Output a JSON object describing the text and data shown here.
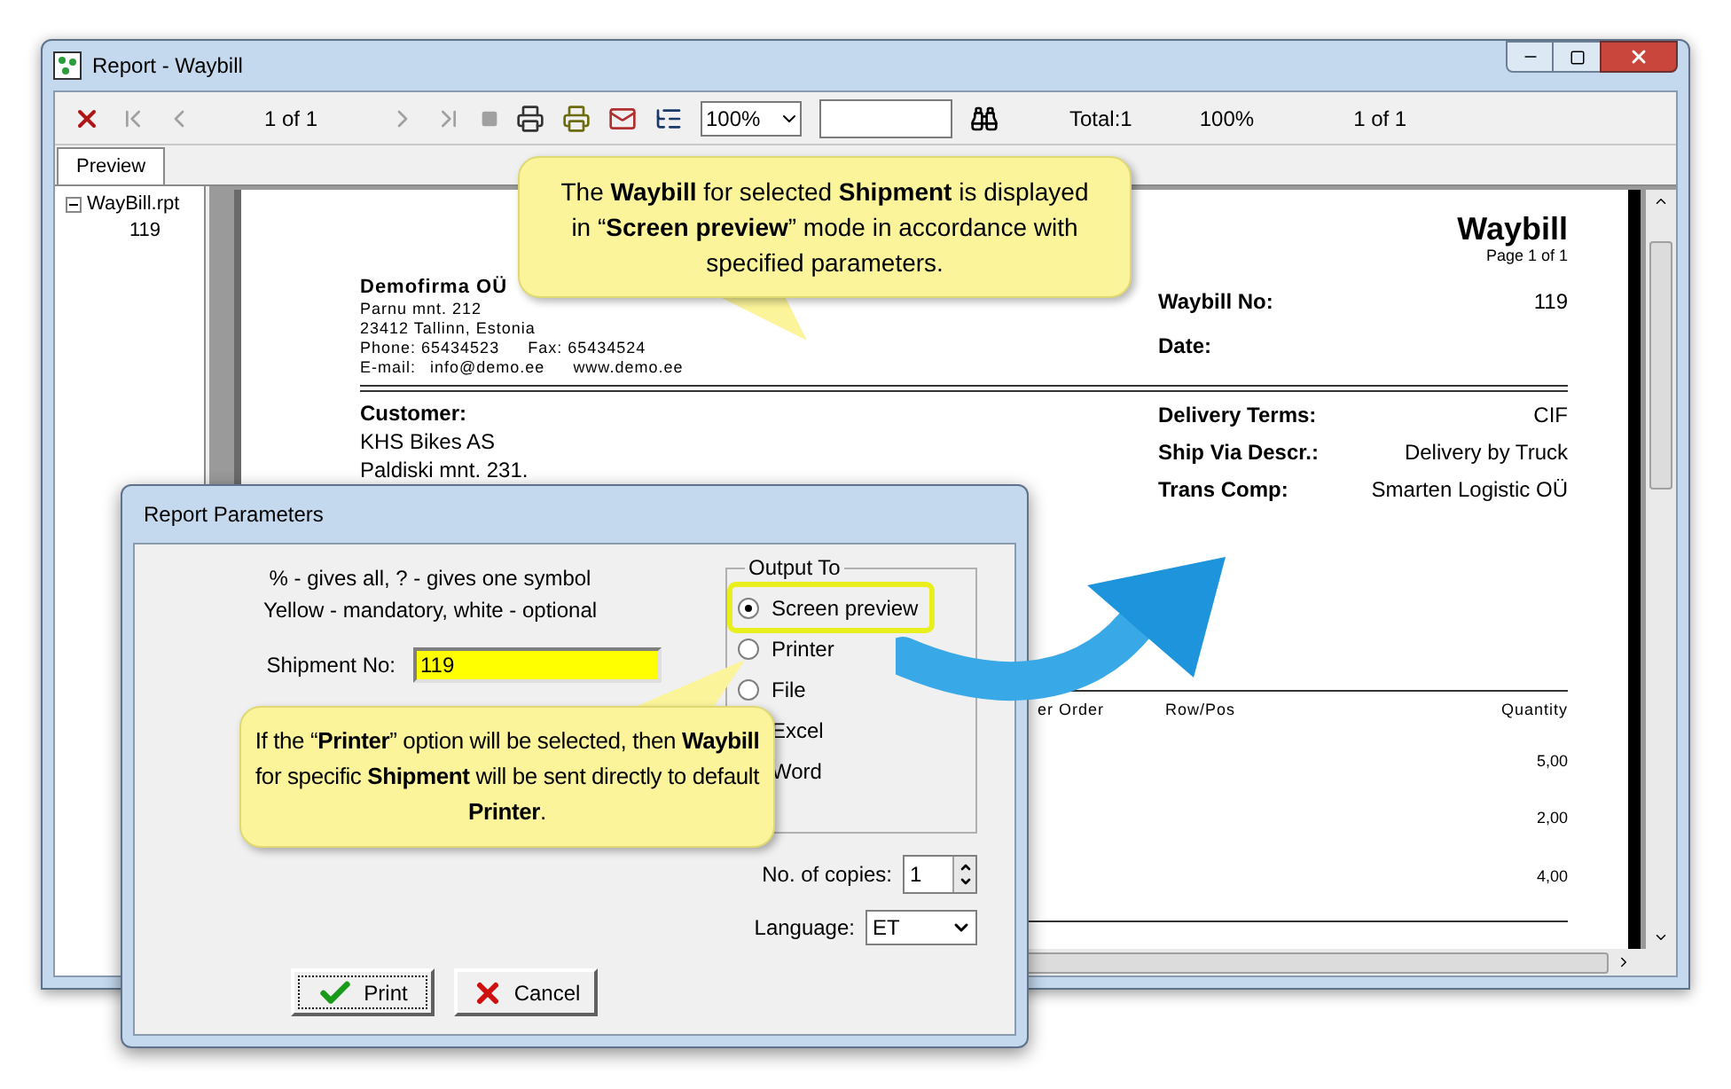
{
  "window": {
    "title": "Report - Waybill"
  },
  "toolbar": {
    "page_indicator": "1 of 1",
    "zoom": "100%",
    "total": "Total:1",
    "zoom_readout": "100%",
    "page_readout": "1 of 1"
  },
  "tabs": [
    {
      "label": "Preview",
      "selected": true
    }
  ],
  "tree": [
    {
      "label": "WayBill.rpt",
      "expanded": true,
      "children": [
        {
          "label": "119"
        }
      ]
    }
  ],
  "report": {
    "title": "Waybill",
    "page": "Page 1 of 1",
    "company": {
      "name": "Demofirma OÜ",
      "lines": [
        "Parnu mnt. 212",
        "23412 Tallinn, Estonia"
      ],
      "phone": "Phone: 65434523",
      "fax": "Fax: 65434524",
      "email_label": "E-mail:",
      "email": "info@demo.ee",
      "web": "www.demo.ee"
    },
    "header_fields": [
      {
        "label": "Waybill No:",
        "value": "119"
      },
      {
        "label": "Date:"
      }
    ],
    "customer": {
      "label": "Customer:",
      "lines": [
        "KHS Bikes AS",
        "Paldiski mnt. 231."
      ]
    },
    "delivery_fields": [
      {
        "label": "Delivery Terms:",
        "value": "CIF"
      },
      {
        "label": "Ship Via Descr.:",
        "value": "Delivery by Truck"
      },
      {
        "label": "Trans Comp:",
        "value": "Smarten Logistic OÜ"
      }
    ],
    "table": {
      "columns": [
        "er Order",
        "Row/Pos",
        "Quantity"
      ],
      "rows": [
        {
          "quantity": "5,00"
        },
        {
          "quantity": "2,00"
        },
        {
          "quantity": "4,00"
        }
      ]
    }
  },
  "dialog": {
    "title": "Report Parameters",
    "hints": [
      "% - gives all, ? - gives one symbol",
      "Yellow - mandatory, white - optional"
    ],
    "field": {
      "label": "Shipment No:",
      "value": "119",
      "mandatory": true
    },
    "output": {
      "label": "Output To",
      "options": [
        {
          "label": "Screen preview",
          "selected": true,
          "highlighted": true
        },
        {
          "label": "Printer",
          "selected": false,
          "highlighted": false
        },
        {
          "label": "File",
          "selected": false,
          "highlighted": false
        },
        {
          "label": "Excel",
          "highlighted": false
        },
        {
          "label": "Word",
          "highlighted": false
        }
      ]
    },
    "copies": {
      "label": "No. of copies:",
      "value": "1"
    },
    "language": {
      "label": "Language:",
      "value": "ET"
    },
    "buttons": [
      {
        "label": "Print",
        "kind": "ok"
      },
      {
        "label": "Cancel",
        "kind": "cancel"
      }
    ]
  },
  "callouts": [
    {
      "text": "The **Waybill** for selected **Shipment** is displayed in “**Screen preview**” mode in accordance with specified parameters."
    },
    {
      "text": "If the “**Printer**” option will be selected, then **Waybill** for specific **Shipment** will be sent directly to default **Printer**."
    }
  ]
}
